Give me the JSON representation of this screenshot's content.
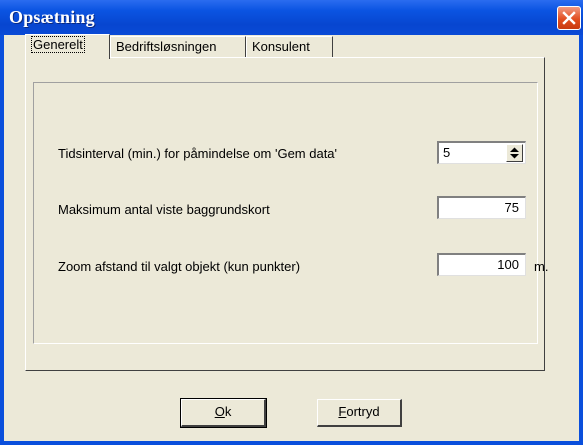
{
  "window": {
    "title": "Opsætning"
  },
  "tabs": [
    {
      "label": "Generelt",
      "active": true
    },
    {
      "label": "Bedriftsløsningen",
      "active": false
    },
    {
      "label": "Konsulent",
      "active": false
    }
  ],
  "settings": {
    "reminder_interval": {
      "label": "Tidsinterval (min.) for påmindelse om 'Gem data'",
      "value": "5"
    },
    "max_backgrounds": {
      "label": "Maksimum antal viste baggrundskort",
      "value": "75"
    },
    "zoom_distance": {
      "label": "Zoom afstand til valgt objekt (kun punkter)",
      "value": "100",
      "unit": "m."
    }
  },
  "buttons": {
    "ok": {
      "mnemonic": "O",
      "rest": "k"
    },
    "cancel": {
      "mnemonic": "F",
      "rest": "ortryd"
    }
  },
  "colors": {
    "titlebar": "#0b54e2",
    "close": "#e24e20",
    "face": "#ece9d8"
  },
  "icons": {
    "close": "close-icon",
    "spin_up": "arrow-up-icon",
    "spin_down": "arrow-down-icon"
  }
}
